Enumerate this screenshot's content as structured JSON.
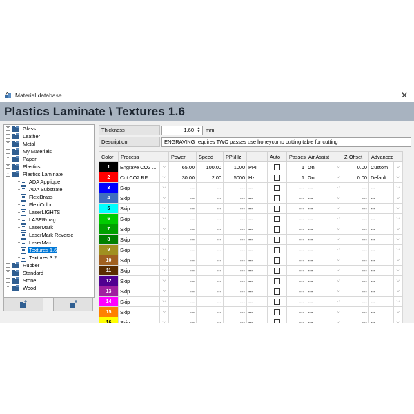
{
  "window": {
    "title": "Material database",
    "close_glyph": "✕"
  },
  "header": {
    "title": "Plastics Laminate \\ Textures 1.6"
  },
  "tree": [
    {
      "label": "Glass",
      "kind": "folder",
      "expand": "+"
    },
    {
      "label": "Leather",
      "kind": "folder",
      "expand": "+"
    },
    {
      "label": "Metal",
      "kind": "folder",
      "expand": "+"
    },
    {
      "label": "My Materials",
      "kind": "folder",
      "expand": "+"
    },
    {
      "label": "Paper",
      "kind": "folder",
      "expand": "+"
    },
    {
      "label": "Plastics",
      "kind": "folder",
      "expand": "+"
    },
    {
      "label": "Plastics Laminate",
      "kind": "folder",
      "expand": "-"
    },
    {
      "label": "ADA Applique",
      "kind": "leaf"
    },
    {
      "label": "ADA Substrate",
      "kind": "leaf"
    },
    {
      "label": "FlexiBrass",
      "kind": "leaf"
    },
    {
      "label": "FlexiColor",
      "kind": "leaf"
    },
    {
      "label": "LaserLIGHTS",
      "kind": "leaf"
    },
    {
      "label": "LASERmag",
      "kind": "leaf"
    },
    {
      "label": "LaserMark",
      "kind": "leaf"
    },
    {
      "label": "LaserMark Reverse",
      "kind": "leaf"
    },
    {
      "label": "LaserMax",
      "kind": "leaf"
    },
    {
      "label": "Textures 1.6",
      "kind": "leaf",
      "selected": true
    },
    {
      "label": "Textures 3.2",
      "kind": "leaf"
    },
    {
      "label": "Rubber",
      "kind": "folder",
      "expand": "+"
    },
    {
      "label": "Standard",
      "kind": "folder",
      "expand": "+"
    },
    {
      "label": "Stone",
      "kind": "folder",
      "expand": "+"
    },
    {
      "label": "Wood",
      "kind": "folder",
      "expand": "+"
    }
  ],
  "tree_buttons": [
    {
      "icon": "folder-add-icon"
    },
    {
      "icon": "material-add-icon"
    }
  ],
  "params": {
    "thickness_label": "Thickness",
    "thickness_value": "1.60",
    "thickness_unit": "mm",
    "description_label": "Description",
    "description_value": "ENGRAVING requires TWO passes use honeycomb cutting table for cutting"
  },
  "columns": [
    "Color",
    "Process",
    "Power",
    "Speed",
    "PPI/Hz",
    "",
    "Auto",
    "Passes",
    "Air Assist",
    "Z-Offset",
    "Advanced"
  ],
  "dash": "---",
  "rows": [
    {
      "num": "1",
      "color": "#000000",
      "process": "Engrave CO2 ...",
      "power": "65.00",
      "speed": "100.00",
      "ppi": "1000",
      "unit": "PPI",
      "passes": "1",
      "air": "On",
      "zoffset": "0.00",
      "advanced": "Custom"
    },
    {
      "num": "2",
      "color": "#ff0000",
      "process": "Cut CO2 RF",
      "power": "30.00",
      "speed": "2.00",
      "ppi": "5000",
      "unit": "Hz",
      "passes": "1",
      "air": "On",
      "zoffset": "0.00",
      "advanced": "Default"
    },
    {
      "num": "3",
      "color": "#0000ff",
      "process": "Skip"
    },
    {
      "num": "4",
      "color": "#3f6fbf",
      "process": "Skip"
    },
    {
      "num": "5",
      "color": "#00ffff",
      "process": "Skip"
    },
    {
      "num": "6",
      "color": "#00cc00",
      "process": "Skip"
    },
    {
      "num": "7",
      "color": "#00a000",
      "process": "Skip"
    },
    {
      "num": "8",
      "color": "#008000",
      "process": "Skip"
    },
    {
      "num": "9",
      "color": "#a09020",
      "process": "Skip"
    },
    {
      "num": "10",
      "color": "#a06020",
      "process": "Skip"
    },
    {
      "num": "11",
      "color": "#5a2d00",
      "process": "Skip"
    },
    {
      "num": "12",
      "color": "#500090",
      "process": "Skip"
    },
    {
      "num": "13",
      "color": "#a020a0",
      "process": "Skip"
    },
    {
      "num": "14",
      "color": "#ff00ff",
      "process": "Skip"
    },
    {
      "num": "15",
      "color": "#ff8000",
      "process": "Skip"
    },
    {
      "num": "16",
      "color": "#ffff00",
      "process": "Skip"
    }
  ]
}
